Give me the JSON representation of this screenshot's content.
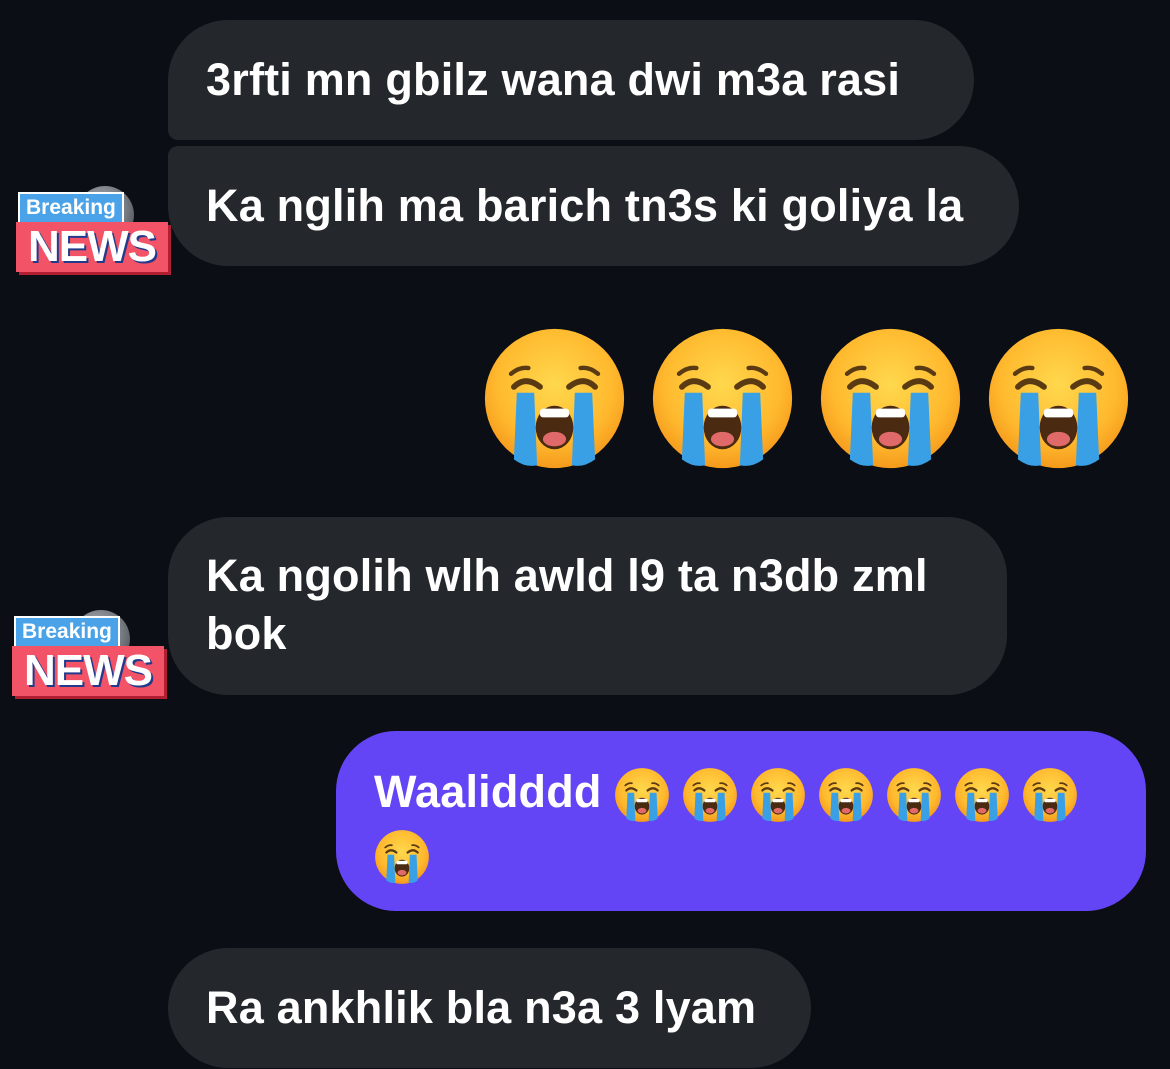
{
  "chat": {
    "messages": [
      {
        "sender": "other",
        "text": "3rfti mn gbilz wana dwi m3a rasi"
      },
      {
        "sender": "other",
        "text": "Ka nglih ma barich tn3s ki goliya la"
      },
      {
        "sender": "me",
        "text": "😭😭😭😭"
      },
      {
        "sender": "other",
        "text": "Ka ngolih wlh awld l9 ta n3db zml\nbok"
      },
      {
        "sender": "me",
        "text": "Waalidddd",
        "emoji_count": 8
      },
      {
        "sender": "other",
        "text": "Ra ankhlik bla n3a 3 lyam"
      }
    ],
    "avatar": {
      "top_text": "Breaking",
      "bottom_text": "NEWS"
    }
  },
  "colors": {
    "background": "#0b0e14",
    "received_bubble": "#24272c",
    "sent_bubble": "#6445f5",
    "text": "#ffffff"
  },
  "icons": {
    "emoji": "loudly-crying-face-icon"
  }
}
